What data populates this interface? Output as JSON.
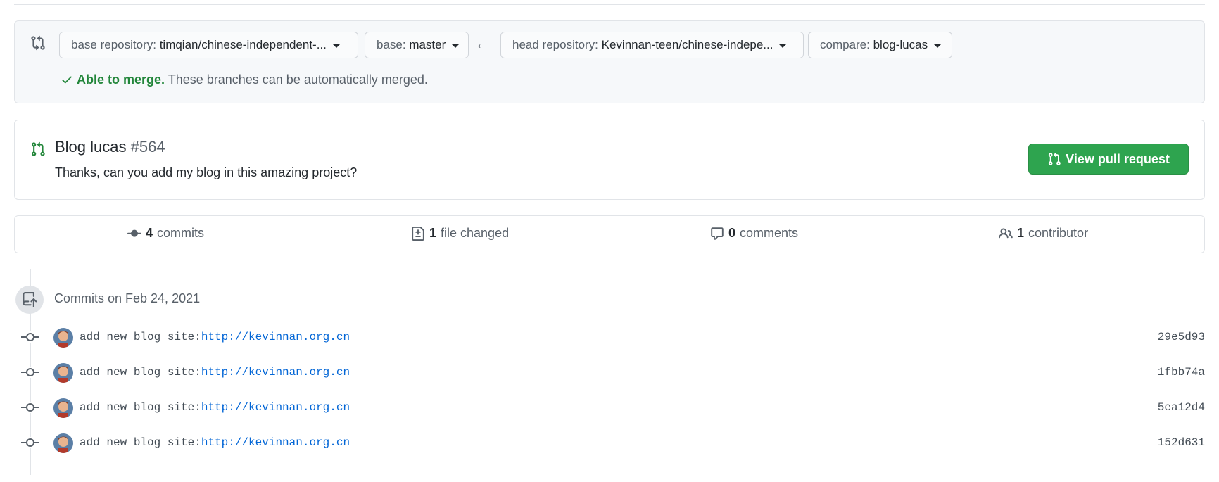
{
  "compare": {
    "base_repo_label": "base repository: ",
    "base_repo_value": "timqian/chinese-independent-...",
    "base_label": "base: ",
    "base_value": "master",
    "arrow": "←",
    "head_repo_label": "head repository: ",
    "head_repo_value": "Kevinnan-teen/chinese-indepe...",
    "compare_label": "compare: ",
    "compare_value": "blog-lucas",
    "merge_ok": "Able to merge.",
    "merge_text": " These branches can be automatically merged."
  },
  "pull_request": {
    "title": "Blog lucas",
    "number": "#564",
    "description": "Thanks, can you add my blog in this amazing project?",
    "view_button": "View pull request"
  },
  "summary": {
    "commits_count": "4",
    "commits_label": "commits",
    "files_count": "1",
    "files_label": "file changed",
    "comments_count": "0",
    "comments_label": "comments",
    "contributors_count": "1",
    "contributors_label": "contributor"
  },
  "timeline": {
    "group_title": "Commits on Feb 24, 2021",
    "commits": [
      {
        "message": "add new blog site:",
        "link": "http://kevinnan.org.cn",
        "sha": "29e5d93"
      },
      {
        "message": "add new blog site:",
        "link": "http://kevinnan.org.cn",
        "sha": "1fbb74a"
      },
      {
        "message": "add new blog site:",
        "link": "http://kevinnan.org.cn",
        "sha": "5ea12d4"
      },
      {
        "message": "add new blog site:",
        "link": "http://kevinnan.org.cn",
        "sha": "152d631"
      }
    ]
  },
  "colors": {
    "success": "#22863a",
    "button_green": "#2ea44f",
    "link": "#0366d6",
    "muted": "#586069",
    "border": "#e1e4e8"
  }
}
